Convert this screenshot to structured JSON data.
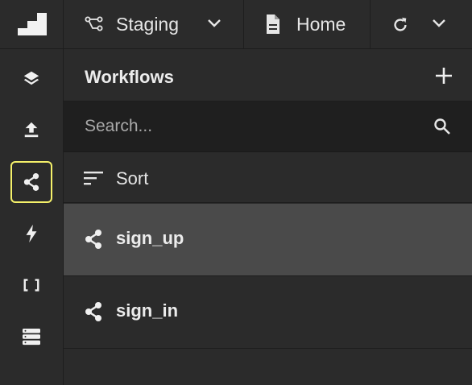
{
  "topbar": {
    "environment_label": "Staging",
    "page_label": "Home"
  },
  "rail": {
    "items": [
      {
        "icon": "layers-icon"
      },
      {
        "icon": "upload-icon"
      },
      {
        "icon": "share-icon",
        "active": true
      },
      {
        "icon": "lightning-icon"
      },
      {
        "icon": "brackets-icon"
      },
      {
        "icon": "database-icon"
      }
    ],
    "active_border_color": "#f5f16a"
  },
  "panel": {
    "title": "Workflows",
    "search_placeholder": "Search...",
    "sort_label": "Sort",
    "workflows": [
      {
        "label": "sign_up",
        "selected": true
      },
      {
        "label": "sign_in",
        "selected": false
      }
    ]
  }
}
